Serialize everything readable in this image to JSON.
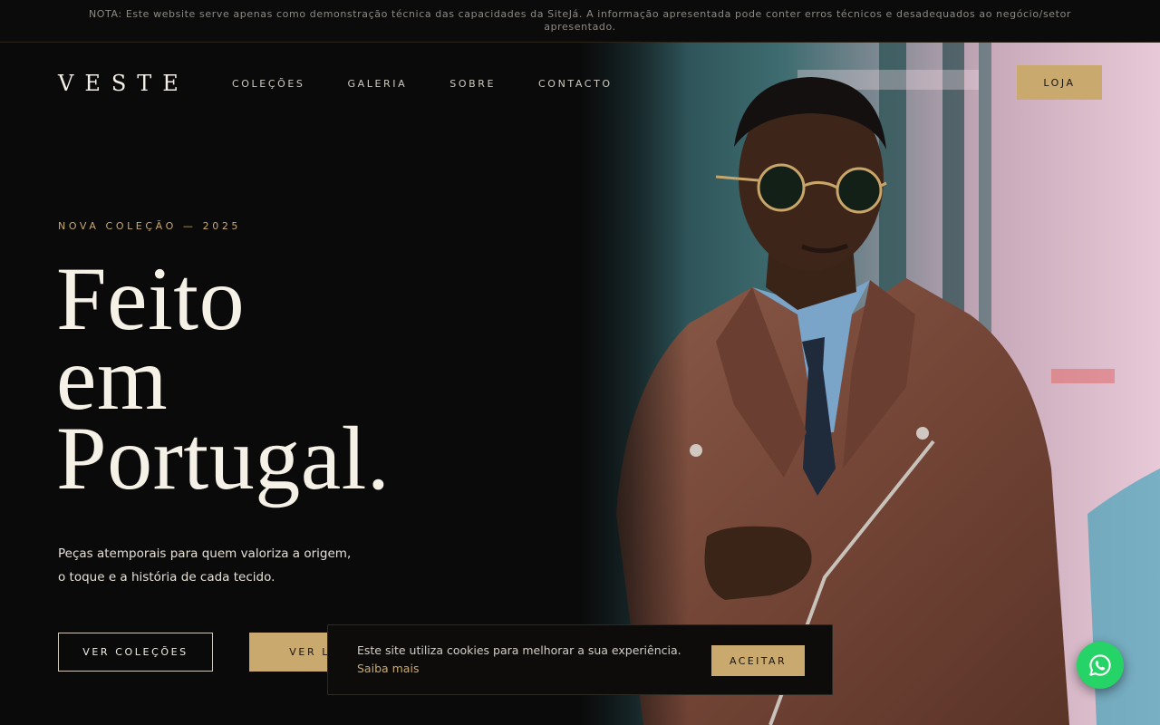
{
  "notice": {
    "text": "NOTA: Este website serve apenas como demonstração técnica das capacidades da SiteJá. A informação apresentada pode conter erros técnicos e desadequados ao negócio/setor apresentado."
  },
  "header": {
    "logo": "VESTE",
    "nav": [
      {
        "label": "COLEÇÕES"
      },
      {
        "label": "GALERIA"
      },
      {
        "label": "SOBRE"
      },
      {
        "label": "CONTACTO"
      }
    ],
    "shop_label": "LOJA"
  },
  "hero": {
    "eyebrow": "NOVA COLEÇÃO — 2025",
    "headline_lines": [
      "Feito",
      "em",
      "Portugal."
    ],
    "lede_line1": "Peças atemporais para quem valoriza a origem,",
    "lede_line2": "o toque e a história de cada tecido.",
    "primary_cta": "VER COLEÇÕES",
    "secondary_cta": "VER LOJA",
    "photo_icon": "man-in-leather-jacket-photo"
  },
  "cookie": {
    "text": "Este site utiliza cookies para melhorar a sua experiência.",
    "link": "Saiba mais",
    "accept": "ACEITAR"
  },
  "whatsapp": {
    "icon": "whatsapp-icon"
  },
  "colors": {
    "background": "#0a0a0a",
    "accent_gold": "#c9a96e",
    "text_light": "#f2ede4",
    "whatsapp_green": "#25d366"
  }
}
